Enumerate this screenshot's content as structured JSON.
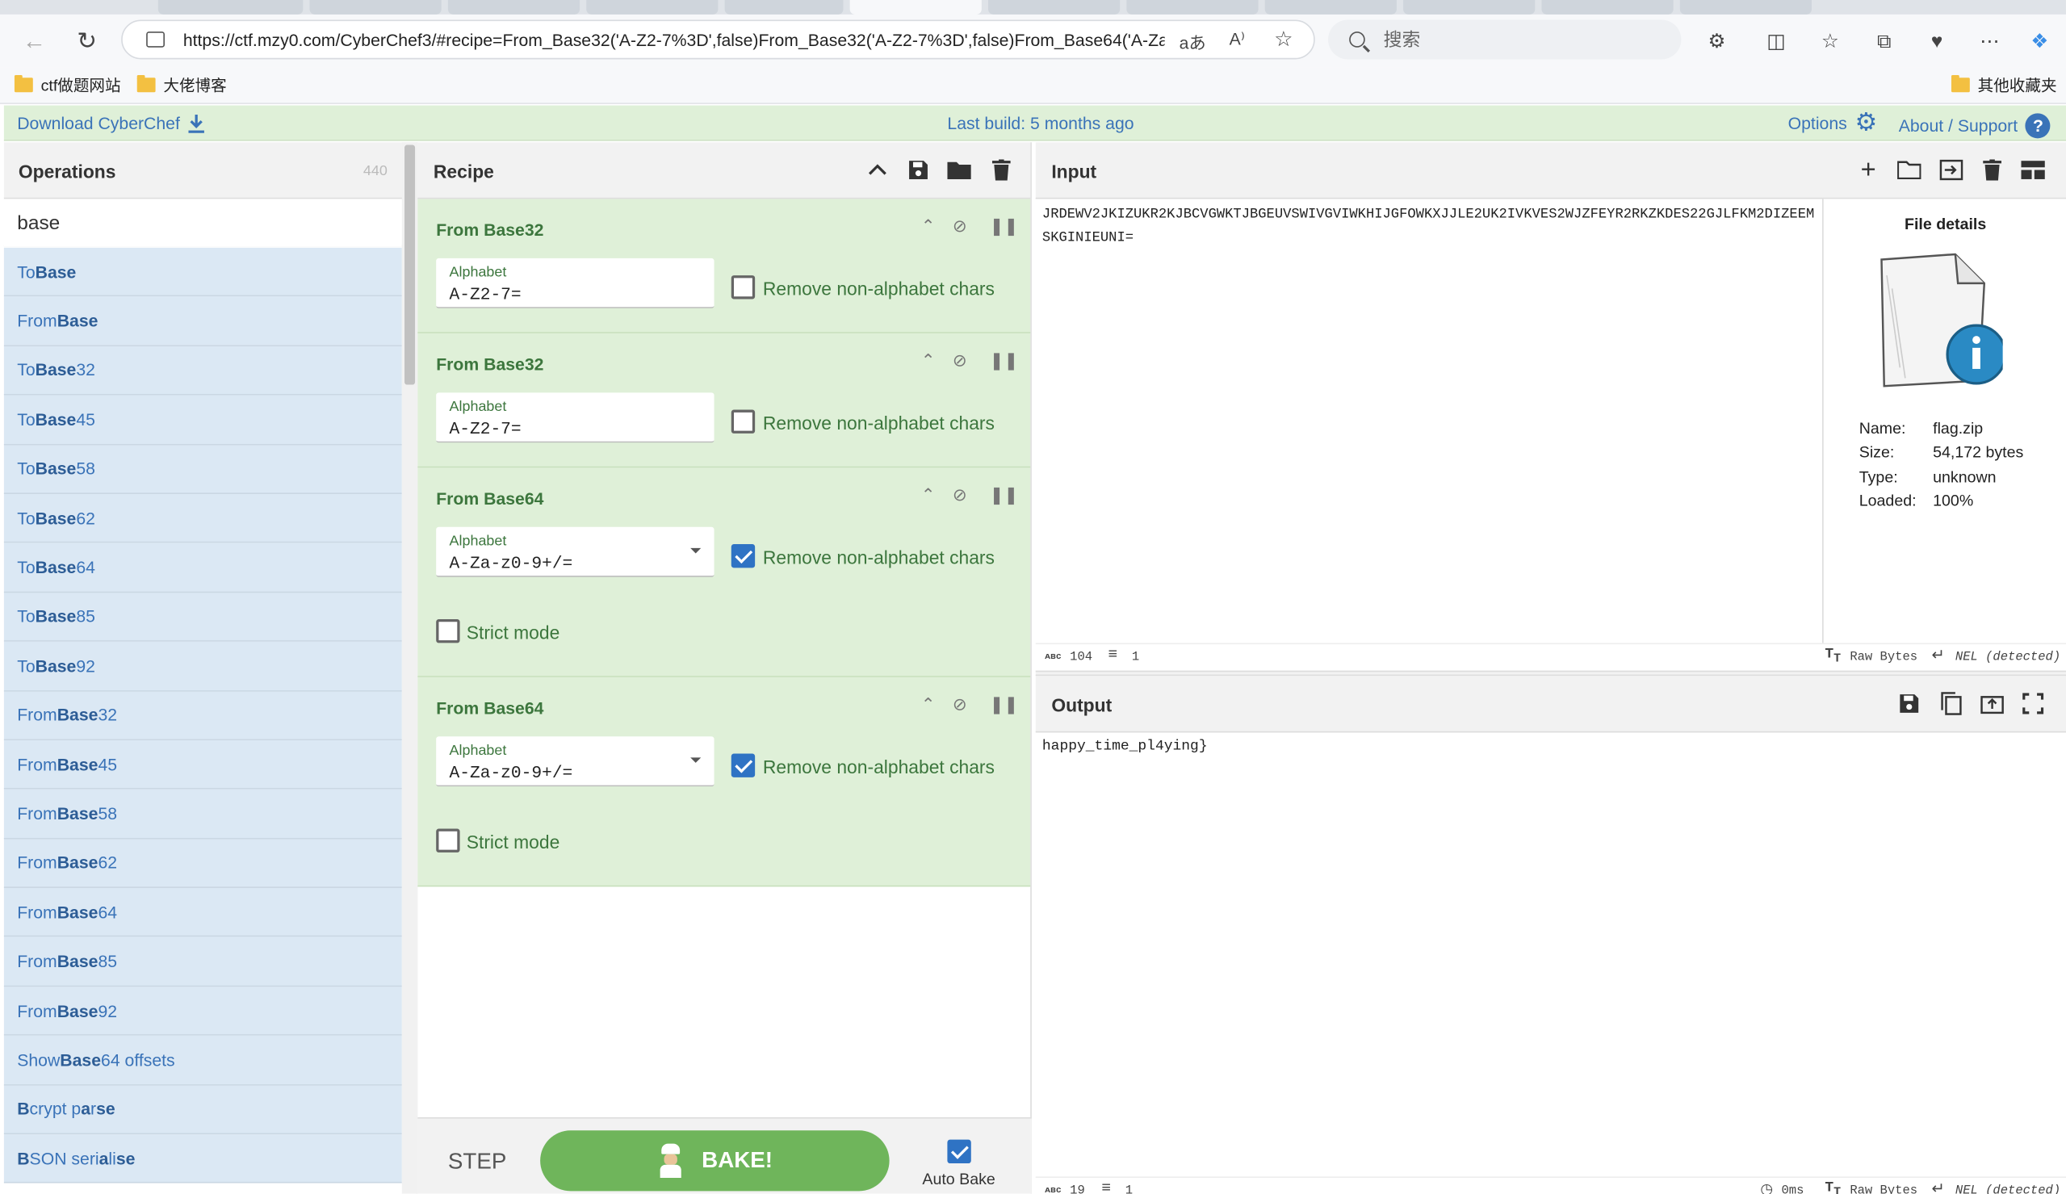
{
  "browser": {
    "url_main": "https://ctf.mzy0.com/CyberChef3/#recipe=From_Base32('A-Z2-7%3D',false)From_Base32('A-Z2-7%3D',false)From_Base64('A-Za-z...",
    "search_placeholder": "搜索",
    "translate_icon": "aあ",
    "read_icon": "A⁾",
    "bookmarks": [
      "ctf做题网站",
      "大佬博客"
    ],
    "other_bookmarks": "其他收藏夹"
  },
  "banner": {
    "download": "Download CyberChef",
    "last_build": "Last build: 5 months ago",
    "options": "Options",
    "about": "About / Support"
  },
  "operations": {
    "title": "Operations",
    "count": "440",
    "search_value": "base",
    "items": [
      {
        "pre": "To ",
        "bold": "Base",
        "post": ""
      },
      {
        "pre": "From ",
        "bold": "Base",
        "post": ""
      },
      {
        "pre": "To ",
        "bold": "Base",
        "post": "32"
      },
      {
        "pre": "To ",
        "bold": "Base",
        "post": "45"
      },
      {
        "pre": "To ",
        "bold": "Base",
        "post": "58"
      },
      {
        "pre": "To ",
        "bold": "Base",
        "post": "62"
      },
      {
        "pre": "To ",
        "bold": "Base",
        "post": "64"
      },
      {
        "pre": "To ",
        "bold": "Base",
        "post": "85"
      },
      {
        "pre": "To ",
        "bold": "Base",
        "post": "92"
      },
      {
        "pre": "From ",
        "bold": "Base",
        "post": "32"
      },
      {
        "pre": "From ",
        "bold": "Base",
        "post": "45"
      },
      {
        "pre": "From ",
        "bold": "Base",
        "post": "58"
      },
      {
        "pre": "From ",
        "bold": "Base",
        "post": "62"
      },
      {
        "pre": "From ",
        "bold": "Base",
        "post": "64"
      },
      {
        "pre": "From ",
        "bold": "Base",
        "post": "85"
      },
      {
        "pre": "From ",
        "bold": "Base",
        "post": "92"
      },
      {
        "pre": "Show ",
        "bold": "Base",
        "post": "64 offsets"
      },
      {
        "pre": "",
        "bold": "B",
        "post": "crypt p",
        "bold2": "a",
        "post2": "r",
        "bold3": "se",
        "post3": ""
      },
      {
        "pre": "",
        "bold": "B",
        "post": "SON seri",
        "bold2": "a",
        "post2": "li",
        "bold3": "se",
        "post3": ""
      }
    ]
  },
  "recipe": {
    "title": "Recipe",
    "ops": [
      {
        "name": "From Base32",
        "alphabet_label": "Alphabet",
        "alphabet": "A-Z2-7=",
        "remove_label": "Remove non-alphabet chars",
        "remove": false
      },
      {
        "name": "From Base32",
        "alphabet_label": "Alphabet",
        "alphabet": "A-Z2-7=",
        "remove_label": "Remove non-alphabet chars",
        "remove": false
      },
      {
        "name": "From Base64",
        "alphabet_label": "Alphabet",
        "alphabet": "A-Za-z0-9+/=",
        "remove_label": "Remove non-alphabet chars",
        "remove": true,
        "strict_label": "Strict mode",
        "strict": false
      },
      {
        "name": "From Base64",
        "alphabet_label": "Alphabet",
        "alphabet": "A-Za-z0-9+/=",
        "remove_label": "Remove non-alphabet chars",
        "remove": true,
        "strict_label": "Strict mode",
        "strict": false
      }
    ],
    "step": "STEP",
    "bake": "BAKE!",
    "auto_bake": "Auto Bake"
  },
  "input": {
    "title": "Input",
    "text": "JRDEWV2JKIZUKR2KJBCVGWKTJBGEUVSWIVGVIWKHIJGFOWKXJJLE2UK2IVKVES2WJZFEYR2RKZKDES22GJLFKM2DIZEEMSKGINIEUNI=",
    "file_details_title": "File details",
    "name_k": "Name:",
    "name_v": "flag.zip",
    "size_k": "Size:",
    "size_v": "54,172 bytes",
    "type_k": "Type:",
    "type_v": "unknown",
    "loaded_k": "Loaded:",
    "loaded_v": "100%",
    "status_len": "104",
    "status_lines": "1",
    "raw_bytes": "Raw Bytes",
    "nel": "NEL (detected)"
  },
  "output": {
    "title": "Output",
    "text": "happy_time_pl4ying}",
    "status_len": "19",
    "status_lines": "1",
    "time": "0ms",
    "raw_bytes": "Raw Bytes",
    "nel": "NEL (detected)"
  },
  "colors": {
    "accent_blue": "#3a73b8",
    "recipe_green": "#dff0d8",
    "bake_green": "#6fb55b",
    "ops_blue": "#dbe8f4"
  }
}
